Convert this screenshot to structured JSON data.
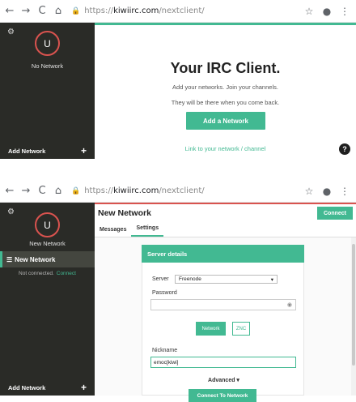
{
  "browser": {
    "back": "←",
    "forward": "→",
    "reload": "C",
    "home": "⌂",
    "lock": "🔒",
    "url_proto": "https://",
    "url_host": "kiwiirc.com",
    "url_path": "/nextclient/",
    "star": "☆",
    "account": "●",
    "menu": "⋮"
  },
  "sidebar": {
    "gear": "⚙",
    "avatar_letter": "U",
    "no_network": "No Network",
    "new_network": "New Network",
    "add_network": "Add Network",
    "plus": "+",
    "network_item": "New Network",
    "list_icon": "☰",
    "status": "Not connected.",
    "status_action": "Connect"
  },
  "welcome": {
    "title": "Your IRC Client.",
    "line1": "Add your networks. Join your channels.",
    "line2": "They will be there when you come back.",
    "button": "Add a Network",
    "link": "Link to your network / channel",
    "help": "?"
  },
  "network_view": {
    "title": "New Network",
    "connect": "Connect",
    "tabs": [
      "Messages",
      "Settings"
    ],
    "active_tab": "Settings",
    "card_title": "Server details",
    "server_label": "Server",
    "server_value": "Freenode",
    "password_label": "Password",
    "password_value": "",
    "network_btn": "Network",
    "znc_btn": "ZNC",
    "nickname_label": "Nickname",
    "nickname_value": "emoc[kiwi]",
    "advanced": "Advanced ▾",
    "connect_to_network": "Connect To Network"
  },
  "colors": {
    "accent": "#42b992",
    "sidebar": "#2a2b27",
    "danger": "#d9534f"
  }
}
